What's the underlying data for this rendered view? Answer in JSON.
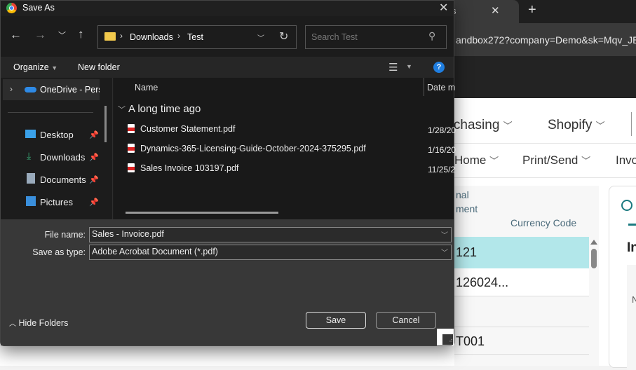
{
  "browser": {
    "tab_label": "s",
    "new_tab": "+",
    "url": "andbox272?company=Demo&sk=Mqv_JEJ",
    "menu": [
      "urchasing",
      "Shopify"
    ],
    "actions": [
      "Home",
      "Print/Send",
      "Invo"
    ],
    "columns": {
      "col1_line1": "nal",
      "col1_line2": "ment",
      "currency": "Currency Code"
    },
    "rows": [
      "121",
      "126024...",
      "T001"
    ],
    "selected_color": "#b2e7ea",
    "card_title": "In",
    "card_field": "N"
  },
  "dialog": {
    "title": "Save As",
    "path": [
      "Downloads",
      "Test"
    ],
    "search_placeholder": "Search Test",
    "toolbar": {
      "organize": "Organize",
      "new_folder": "New folder"
    },
    "sidebar": [
      {
        "label": "OneDrive - Perso",
        "pinned": false
      },
      {
        "label": "Desktop",
        "pinned": true
      },
      {
        "label": "Downloads",
        "pinned": true
      },
      {
        "label": "Documents",
        "pinned": true
      },
      {
        "label": "Pictures",
        "pinned": true
      }
    ],
    "columns": {
      "name": "Name",
      "date": "Date m"
    },
    "group": "A long time ago",
    "files": [
      {
        "name": "Customer Statement.pdf",
        "date": "1/28/20"
      },
      {
        "name": "Dynamics-365-Licensing-Guide-October-2024-375295.pdf",
        "date": "1/16/20"
      },
      {
        "name": "Sales Invoice 103197.pdf",
        "date": "11/25/2"
      }
    ],
    "file_name_label": "File name:",
    "file_name": "Sales - Invoice.pdf",
    "save_type_label": "Save as type:",
    "save_type": "Adobe Acrobat Document (*.pdf)",
    "hide_folders": "Hide Folders",
    "save": "Save",
    "cancel": "Cancel"
  }
}
